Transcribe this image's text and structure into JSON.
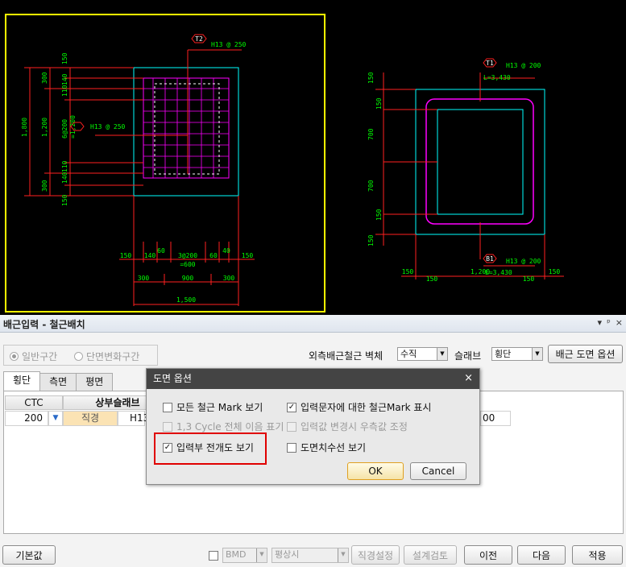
{
  "drawing": {
    "left": {
      "dims_vertical": [
        "1,800",
        "300",
        "1,200",
        "300",
        "150",
        "140",
        "110",
        "6@200",
        "=1,200",
        "110",
        "140",
        "150"
      ],
      "dims_horizontal_top": [
        "150",
        "140",
        "60",
        "3@200",
        "=600",
        "60",
        "40",
        "150"
      ],
      "dims_horizontal_mid": [
        "300",
        "900",
        "300"
      ],
      "dims_horizontal_total": "1,500",
      "tag_t2": "T2",
      "rebar_t2": "H13 @ 250",
      "rebar_side": "H13 @ 250"
    },
    "right": {
      "dims_vertical": [
        "150",
        "150",
        "700",
        "700",
        "150",
        "150"
      ],
      "tag_t1": "T1",
      "rebar_t1": "H13 @ 200",
      "length_t1": "L=3,430",
      "tag_b1": "B1",
      "rebar_b1": "H13 @ 200",
      "length_b1": "L=3,430",
      "dims_horizontal": [
        "150",
        "150",
        "1,200",
        "150",
        "150"
      ]
    }
  },
  "panel": {
    "title": "배근입력 - 철근배치",
    "title_icons": [
      "▾",
      "ᵖ",
      "×"
    ],
    "radio_general": "일반구간",
    "radio_section_change": "단면변화구간",
    "outer_wall_label": "외측배근철근 벽체",
    "outer_wall_value": "수직",
    "slab_label": "슬래브",
    "slab_value": "횡단",
    "drawing_options_button": "배근 도면 옵션",
    "tabs": [
      "횡단",
      "측면",
      "평면"
    ],
    "grid_headers": [
      "CTC",
      "상부슬래브"
    ],
    "grid_row": {
      "ctc": "200",
      "type": "직경",
      "bar": "H13",
      "right_value": "00"
    },
    "footer": {
      "default_button": "기본값",
      "bmd": "BMD",
      "normal": "평상시",
      "diameter_button": "직경설정",
      "design_check_button": "설계검토",
      "prev_button": "이전",
      "next_button": "다음",
      "apply_button": "적용"
    }
  },
  "dialog": {
    "title": "도면 옵션",
    "close": "×",
    "options": {
      "all_mark": "모든 철근 Mark 보기",
      "input_mark": "입력문자에 대한 철근Mark 표시",
      "cycle": "1,3 Cycle 전체 이음 표기",
      "value_change": "입력값 변경시 우측값 조정",
      "expanded": "입력부 전개도 보기",
      "dimension_lines": "도면치수선 보기"
    },
    "ok": "OK",
    "cancel": "Cancel"
  },
  "colors": {
    "cad_bg": "#000000",
    "cad_green": "#00ff00",
    "cad_red": "#ff2020",
    "cad_cyan": "#00ffff",
    "cad_magenta": "#ff00ff",
    "cad_yellow": "#ffff00",
    "highlight_red": "#e00000"
  }
}
